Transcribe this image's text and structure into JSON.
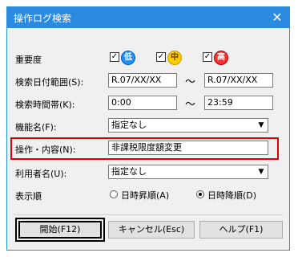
{
  "dialog": {
    "title": "操作ログ検索",
    "close_glyph": "✕"
  },
  "importance": {
    "label": "重要度",
    "options": [
      {
        "glyph": "低",
        "checked": true,
        "color": "#1e90ff"
      },
      {
        "glyph": "中",
        "checked": true,
        "color": "#ffcc00"
      },
      {
        "glyph": "高",
        "checked": true,
        "color": "#ff3030"
      }
    ]
  },
  "date_range": {
    "label": "検索日付範囲(S):",
    "from": "R.07/XX/XX",
    "to": "R.07/XX/XX",
    "sep": "～"
  },
  "time_range": {
    "label": "検索時間帯(K):",
    "from": "0:00",
    "to": "23:59",
    "sep": "～"
  },
  "function_name": {
    "label": "機能名(F):",
    "value": "指定なし"
  },
  "operation": {
    "label": "操作・内容(N):",
    "value": "非課税限度額変更"
  },
  "user_name": {
    "label": "利用者名(U):",
    "value": "指定なし"
  },
  "sort_order": {
    "label": "表示順",
    "options": [
      {
        "label": "日時昇順(A)",
        "selected": false
      },
      {
        "label": "日時降順(D)",
        "selected": true
      }
    ]
  },
  "buttons": {
    "start": "開始(F12)",
    "cancel": "キャンセル(Esc)",
    "help": "ヘルプ(F1)"
  },
  "colors": {
    "titlebar": "#2b8ae0",
    "highlight": "#e00000"
  }
}
